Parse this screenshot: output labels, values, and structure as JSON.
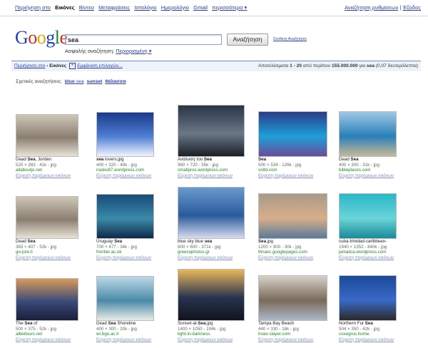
{
  "nav": {
    "items": [
      "Περιήγηση στο",
      "Εικόνες",
      "Βίντεο",
      "Μεταφράσεις",
      "Ιστολόγιο",
      "Ημερολόγιο",
      "Gmail",
      "περισσότερα ▾"
    ],
    "active_index": 1,
    "right": [
      "Αναζήτηση ρυθμίσεων",
      "Έξοδος"
    ]
  },
  "logo": {
    "letters": [
      "G",
      "o",
      "o",
      "g",
      "l",
      "e"
    ]
  },
  "search": {
    "query": "sea",
    "button": "Αναζήτηση",
    "advanced": "Σύνθετη Αναζήτηση",
    "safe_label": "Ασφαλής αναζήτηση:",
    "safe_value": "Περιορισμένη ▾"
  },
  "results_bar": {
    "link": "Περιήγηση στο",
    "sep": "›",
    "current": "Εικόνες",
    "options": "Εμφάνιση επιλογών...",
    "summary_prefix": "Αποτελέσματα",
    "range": "1 - 20",
    "middle": "από περίπου",
    "total": "155.000.000",
    "for_word": "για",
    "term": "sea",
    "time": "(0,07 δευτερόλεπτα)"
  },
  "related": {
    "label": "Σχετικές αναζητήσεις:",
    "items": [
      {
        "bold": "blue",
        "normal": " sea"
      },
      {
        "bold": "sunset",
        "normal": ""
      },
      {
        "bold": "θάλασσα",
        "normal": ""
      }
    ]
  },
  "more_label": "Εύρεση παρόμοιων εικόνων",
  "thumb_icon": "image-thumbnail",
  "images": [
    {
      "pre": "Dead ",
      "bold": "Sea",
      "post": ", Jordan",
      "meta": "520 × 383 - 41k - jpg",
      "site": "allaboutjo.net",
      "colors": [
        "#cfc6b8",
        "#8a7e70",
        "#e8e2d6"
      ]
    },
    {
      "pre": "",
      "bold": "sea",
      "post": " lovers.jpg",
      "meta": "400 × 320 - 40k - jpg",
      "site": "nasko87.wordpress.com",
      "colors": [
        "#1a3a8a",
        "#4f7fd4",
        "#f0f4ff"
      ]
    },
    {
      "pre": "Ανάλυση του ",
      "bold": "Sea",
      "post": "",
      "meta": "960 × 720 - 55k - jpg",
      "site": "smallpros.wordpress.com",
      "colors": [
        "#2a3444",
        "#6a7888",
        "#1a2028"
      ]
    },
    {
      "pre": "",
      "bold": "Sea",
      "post": "",
      "meta": "500 × 534 - 126k - jpg",
      "site": "voltd.com",
      "colors": [
        "#2a3c8a",
        "#1e9fd8",
        "#6a4c9a"
      ]
    },
    {
      "pre": "Dead ",
      "bold": "Sea",
      "post": "",
      "meta": "400 × 300 - 31k - jpg",
      "site": "bibleplaces.com",
      "colors": [
        "#9cc8e8",
        "#2a7fb8",
        "#c8b89a"
      ]
    },
    {
      "pre": "Dead ",
      "bold": "Sea",
      "post": "",
      "meta": "383 × 407 - 52k - jpg",
      "site": "go-jore.li",
      "colors": [
        "#cfc6b8",
        "#8a7e70",
        "#e8e2d6"
      ]
    },
    {
      "pre": "Uruguay ",
      "bold": "Sea",
      "post": "",
      "meta": "700 × 477 - 34k - jpg",
      "site": "frontier.ac.uk",
      "colors": [
        "#1a4a7a",
        "#3a8aaa",
        "#0e2a4a"
      ]
    },
    {
      "pre": "blue sky blue ",
      "bold": "sea",
      "post": "",
      "meta": "800 × 600 - 371k - jpg",
      "site": "greecephotos.gr",
      "colors": [
        "#6a9ad0",
        "#2a5a9a",
        "#d4dcee"
      ]
    },
    {
      "pre": "",
      "bold": "Sea",
      "post": ".jpg",
      "meta": "1200 × 900 - 30k - jpg",
      "site": "thnavc.googlepages.com",
      "colors": [
        "#a89a8a",
        "#d8ae8a",
        "#5a7a9a"
      ]
    },
    {
      "pre": "cuba-trinidad-caribbean-",
      "bold": "",
      "post": "",
      "meta": "1940 × 1352 - 840k - jpg",
      "site": "jamaiica.wordpress.com",
      "colors": [
        "#2ab8c8",
        "#6ad4d8",
        "#1a8a9a"
      ]
    },
    {
      "pre": "The ",
      "bold": "Sea",
      "post": " of",
      "meta": "500 × 375 - 52k - jpg",
      "site": "albeitours.net",
      "colors": [
        "#d89a5a",
        "#3a4a7a",
        "#1a1e3a"
      ]
    },
    {
      "pre": "Dead ",
      "bold": "Sea",
      "post": " Shoreline",
      "meta": "400 × 300 - 20k - jpg",
      "site": "wr.bgu.ac.il",
      "colors": [
        "#bcd8e8",
        "#4a8aa8",
        "#e8ece6"
      ]
    },
    {
      "pre": "Sunset-at-",
      "bold": "Sea",
      "post": ".jpg",
      "meta": "1400 × 1050 - 194k - jpg",
      "site": "light-in-darkness.",
      "colors": [
        "#e8b85a",
        "#2a3450",
        "#10141e"
      ]
    },
    {
      "pre": "Tampa Bay Beach",
      "bold": "",
      "post": "",
      "meta": "440 × 330 - 18k - jpg",
      "site": "hoax-slayer.com",
      "colors": [
        "#d8d0c8",
        "#7a6a5a",
        "#aab8c8"
      ]
    },
    {
      "pre": "Northern Fur ",
      "bold": "Sea",
      "post": "",
      "meta": "504 × 350 - 42k - jpg",
      "site": "coxegrus.home.",
      "colors": [
        "#1a4a9a",
        "#3a6ac8",
        "#2a2a2a"
      ]
    }
  ]
}
